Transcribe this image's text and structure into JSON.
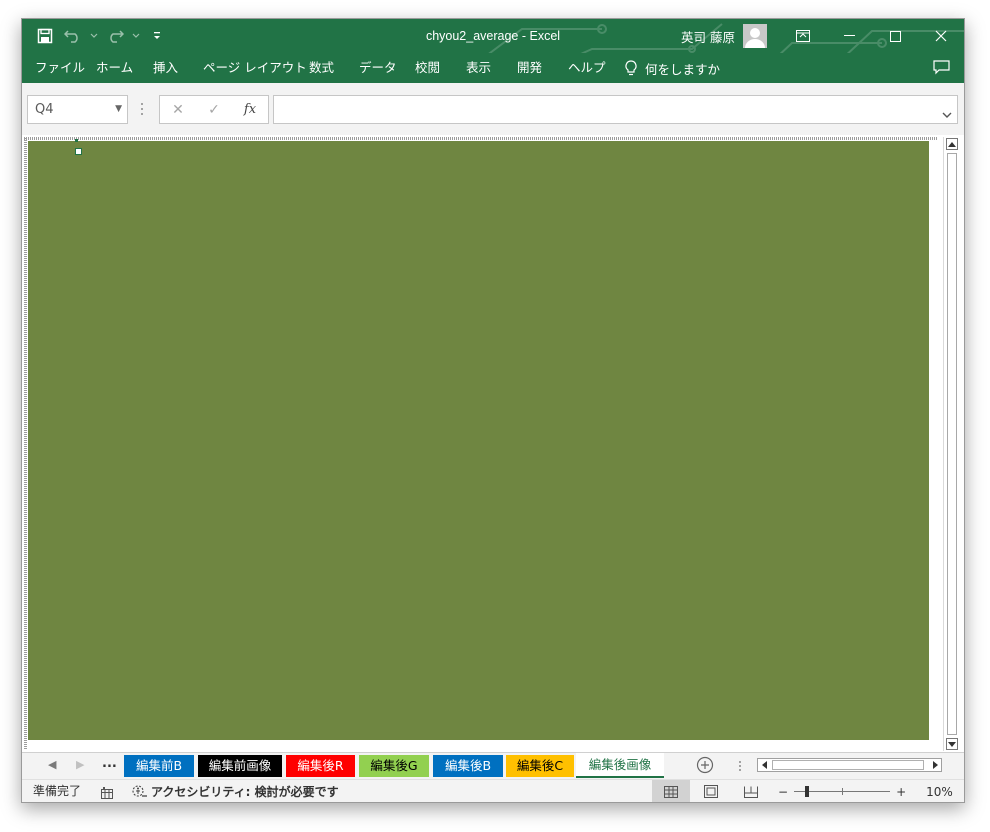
{
  "window": {
    "title": "chyou2_average  -  Excel",
    "user_name": "英司 藤原"
  },
  "ribbon": {
    "tabs": [
      {
        "label": "ファイル"
      },
      {
        "label": "ホーム"
      },
      {
        "label": "挿入"
      },
      {
        "label": "ページ レイアウト"
      },
      {
        "label": "数式"
      },
      {
        "label": "データ"
      },
      {
        "label": "校閲"
      },
      {
        "label": "表示"
      },
      {
        "label": "開発"
      },
      {
        "label": "ヘルプ"
      }
    ],
    "tell_me": "何をしますか"
  },
  "formula_bar": {
    "name_box": "Q4",
    "fx_label": "fx",
    "formula": ""
  },
  "sheet": {
    "image_color": "#6f8641"
  },
  "sheet_tabs": {
    "ellipsis": "...",
    "tabs": [
      {
        "label": "編集前B",
        "bg": "#0070c0",
        "fg": "#ffffff"
      },
      {
        "label": "編集前画像",
        "bg": "#000000",
        "fg": "#ffffff"
      },
      {
        "label": "編集後R",
        "bg": "#ff0000",
        "fg": "#ffffff"
      },
      {
        "label": "編集後G",
        "bg": "#92d050",
        "fg": "#000000"
      },
      {
        "label": "編集後B",
        "bg": "#0070c0",
        "fg": "#ffffff"
      },
      {
        "label": "編集後C",
        "bg": "#ffc000",
        "fg": "#000000"
      },
      {
        "label": "編集後画像",
        "bg": "#ffffff",
        "fg": "#217346",
        "active": true
      }
    ]
  },
  "status_bar": {
    "ready": "準備完了",
    "accessibility": "アクセシビリティ: 検討が必要です",
    "zoom_level": "10%",
    "zoom_minus": "−",
    "zoom_plus": "+"
  },
  "colors": {
    "excel_green": "#217346"
  }
}
